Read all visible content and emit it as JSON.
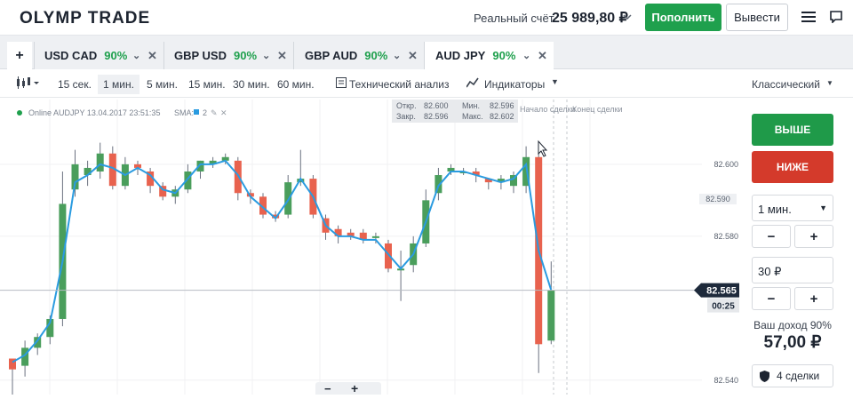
{
  "header": {
    "logo": "OLYMP TRADE",
    "account_label": "Реальный счёт",
    "balance": "25 989,80 ₽",
    "deposit_label": "Пополнить",
    "withdraw_label": "Вывести"
  },
  "tabs": [
    {
      "pair": "USD CAD",
      "percent": "90%"
    },
    {
      "pair": "GBP USD",
      "percent": "90%"
    },
    {
      "pair": "GBP AUD",
      "percent": "90%"
    },
    {
      "pair": "AUD JPY",
      "percent": "90%",
      "active": true
    }
  ],
  "add_tab_label": "+",
  "toolbar": {
    "timeframes": [
      "15 сек.",
      "1 мин.",
      "5 мин.",
      "15 мин.",
      "30 мин.",
      "60 мин."
    ],
    "selected_timeframe": "1 мин.",
    "tech_label": "Технический анализ",
    "indicators_label": "Индикаторы",
    "chart_style": "Классический"
  },
  "chart_info": {
    "status": "Online AUDJPY 13.04.2017 23:51:35",
    "sma_label": "SMA:",
    "sma_value": "2",
    "ohlc": {
      "open_label": "Откр.",
      "open": "82.600",
      "close_label": "Закр.",
      "close": "82.596",
      "min_label": "Мин.",
      "min": "82.596",
      "max_label": "Макс.",
      "max": "82.602"
    },
    "start_label": "Начало сделки",
    "end_label": "Конец сделки",
    "current_price": "82.565",
    "countdown": "00:25",
    "price_badge": "82.590"
  },
  "chart_data": {
    "type": "candlestick",
    "yticks": [
      82.6,
      82.58,
      82.54
    ],
    "ylim": [
      82.536,
      82.618
    ],
    "candles": [
      {
        "o": 82.546,
        "c": 82.543,
        "h": 82.545,
        "l": 82.533
      },
      {
        "o": 82.544,
        "c": 82.549,
        "h": 82.551,
        "l": 82.541
      },
      {
        "o": 82.549,
        "c": 82.552,
        "h": 82.553,
        "l": 82.547
      },
      {
        "o": 82.552,
        "c": 82.557,
        "h": 82.558,
        "l": 82.55
      },
      {
        "o": 82.557,
        "c": 82.589,
        "h": 82.598,
        "l": 82.555
      },
      {
        "o": 82.593,
        "c": 82.6,
        "h": 82.604,
        "l": 82.591
      },
      {
        "o": 82.597,
        "c": 82.599,
        "h": 82.601,
        "l": 82.594
      },
      {
        "o": 82.598,
        "c": 82.603,
        "h": 82.606,
        "l": 82.596
      },
      {
        "o": 82.603,
        "c": 82.594,
        "h": 82.605,
        "l": 82.593
      },
      {
        "o": 82.594,
        "c": 82.6,
        "h": 82.602,
        "l": 82.593
      },
      {
        "o": 82.6,
        "c": 82.599,
        "h": 82.601,
        "l": 82.597
      },
      {
        "o": 82.598,
        "c": 82.594,
        "h": 82.599,
        "l": 82.592
      },
      {
        "o": 82.594,
        "c": 82.591,
        "h": 82.595,
        "l": 82.59
      },
      {
        "o": 82.591,
        "c": 82.593,
        "h": 82.594,
        "l": 82.589
      },
      {
        "o": 82.593,
        "c": 82.598,
        "h": 82.6,
        "l": 82.592
      },
      {
        "o": 82.598,
        "c": 82.601,
        "h": 82.601,
        "l": 82.596
      },
      {
        "o": 82.6,
        "c": 82.601,
        "h": 82.602,
        "l": 82.599
      },
      {
        "o": 82.601,
        "c": 82.602,
        "h": 82.603,
        "l": 82.6
      },
      {
        "o": 82.601,
        "c": 82.592,
        "h": 82.602,
        "l": 82.59
      },
      {
        "o": 82.592,
        "c": 82.591,
        "h": 82.593,
        "l": 82.589
      },
      {
        "o": 82.591,
        "c": 82.586,
        "h": 82.592,
        "l": 82.585
      },
      {
        "o": 82.586,
        "c": 82.585,
        "h": 82.587,
        "l": 82.584
      },
      {
        "o": 82.586,
        "c": 82.595,
        "h": 82.597,
        "l": 82.585
      },
      {
        "o": 82.595,
        "c": 82.596,
        "h": 82.604,
        "l": 82.594
      },
      {
        "o": 82.596,
        "c": 82.586,
        "h": 82.597,
        "l": 82.585
      },
      {
        "o": 82.585,
        "c": 82.581,
        "h": 82.586,
        "l": 82.579
      },
      {
        "o": 82.582,
        "c": 82.58,
        "h": 82.583,
        "l": 82.578
      },
      {
        "o": 82.581,
        "c": 82.58,
        "h": 82.582,
        "l": 82.579
      },
      {
        "o": 82.581,
        "c": 82.579,
        "h": 82.582,
        "l": 82.578
      },
      {
        "o": 82.58,
        "c": 82.58,
        "h": 82.581,
        "l": 82.578
      },
      {
        "o": 82.578,
        "c": 82.571,
        "h": 82.579,
        "l": 82.57
      },
      {
        "o": 82.571,
        "c": 82.571,
        "h": 82.576,
        "l": 82.562
      },
      {
        "o": 82.572,
        "c": 82.578,
        "h": 82.58,
        "l": 82.57
      },
      {
        "o": 82.578,
        "c": 82.59,
        "h": 82.593,
        "l": 82.577
      },
      {
        "o": 82.592,
        "c": 82.597,
        "h": 82.599,
        "l": 82.59
      },
      {
        "o": 82.598,
        "c": 82.599,
        "h": 82.6,
        "l": 82.597
      },
      {
        "o": 82.598,
        "c": 82.598,
        "h": 82.599,
        "l": 82.597
      },
      {
        "o": 82.598,
        "c": 82.597,
        "h": 82.599,
        "l": 82.595
      },
      {
        "o": 82.596,
        "c": 82.595,
        "h": 82.596,
        "l": 82.593
      },
      {
        "o": 82.595,
        "c": 82.596,
        "h": 82.597,
        "l": 82.593
      },
      {
        "o": 82.594,
        "c": 82.597,
        "h": 82.598,
        "l": 82.592
      },
      {
        "o": 82.594,
        "c": 82.602,
        "h": 82.605,
        "l": 82.592
      },
      {
        "o": 82.602,
        "c": 82.55,
        "h": 82.603,
        "l": 82.542
      },
      {
        "o": 82.551,
        "c": 82.565,
        "h": 82.573,
        "l": 82.55
      }
    ],
    "sma": [
      82.545,
      82.547,
      82.551,
      82.556,
      82.573,
      82.595,
      82.597,
      82.6,
      82.599,
      82.597,
      82.599,
      82.597,
      82.593,
      82.592,
      82.596,
      82.6,
      82.6,
      82.601,
      82.597,
      82.591,
      82.588,
      82.585,
      82.59,
      82.596,
      82.591,
      82.583,
      82.58,
      82.58,
      82.579,
      82.579,
      82.575,
      82.571,
      82.575,
      82.584,
      82.594,
      82.598,
      82.598,
      82.597,
      82.596,
      82.595,
      82.596,
      82.6,
      82.576,
      82.565
    ]
  },
  "side": {
    "up_label": "ВЫШЕ",
    "down_label": "НИЖЕ",
    "duration": "1 мин.",
    "minus": "−",
    "plus": "+",
    "amount": "30 ₽",
    "income_label": "Ваш доход 90%",
    "income_value": "57,00 ₽",
    "deals_label": "4 сделки"
  },
  "zoom": {
    "minus": "−",
    "plus": "+"
  },
  "colors": {
    "green": "#1fa04d",
    "red": "#d43a2b",
    "accent": "#2a9be0",
    "ohlc_bg": "#e8eaed",
    "price_tag": "#1e2a3b"
  }
}
